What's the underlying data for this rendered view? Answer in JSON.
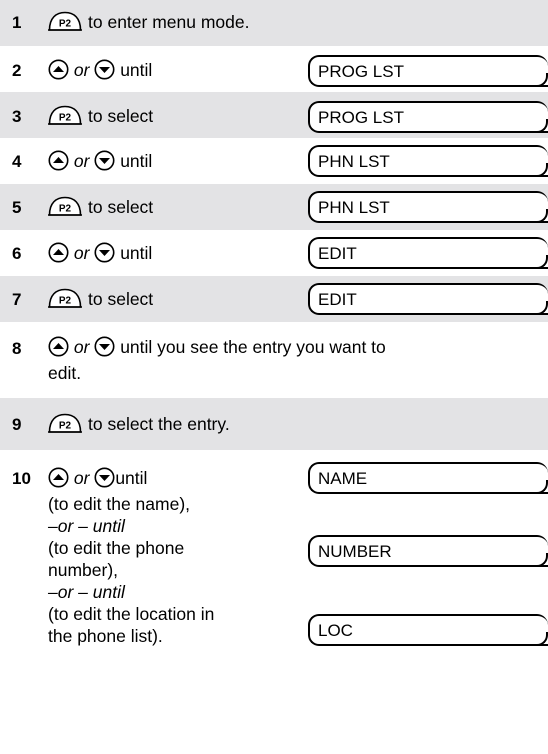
{
  "icons": {
    "p2": "P2",
    "up": "up-arrow-icon",
    "down": "down-arrow-icon"
  },
  "steps": [
    {
      "num": "1",
      "text": "to enter menu mode."
    },
    {
      "num": "2",
      "or": "or",
      "text": "until",
      "display": "PROG LST"
    },
    {
      "num": "3",
      "text": "to select",
      "display": "PROG LST"
    },
    {
      "num": "4",
      "or": "or",
      "text": "until",
      "display": "PHN LST"
    },
    {
      "num": "5",
      "text": "to select",
      "display": "PHN LST"
    },
    {
      "num": "6",
      "or": "or",
      "text": "until",
      "display": "EDIT"
    },
    {
      "num": "7",
      "text": "to select",
      "display": "EDIT"
    },
    {
      "num": "8",
      "or": "or",
      "text": "until you see the entry you want to",
      "text2": "edit."
    },
    {
      "num": "9",
      "text": "to select the entry."
    },
    {
      "num": "10",
      "or": "or",
      "text": "until",
      "lines": [
        "(to edit the name),",
        "–or –  until",
        "(to edit the phone",
        "number),",
        "–or –  until",
        "(to edit the location in",
        "the phone list)."
      ],
      "displays": [
        "NAME",
        "NUMBER",
        "LOC"
      ]
    }
  ]
}
